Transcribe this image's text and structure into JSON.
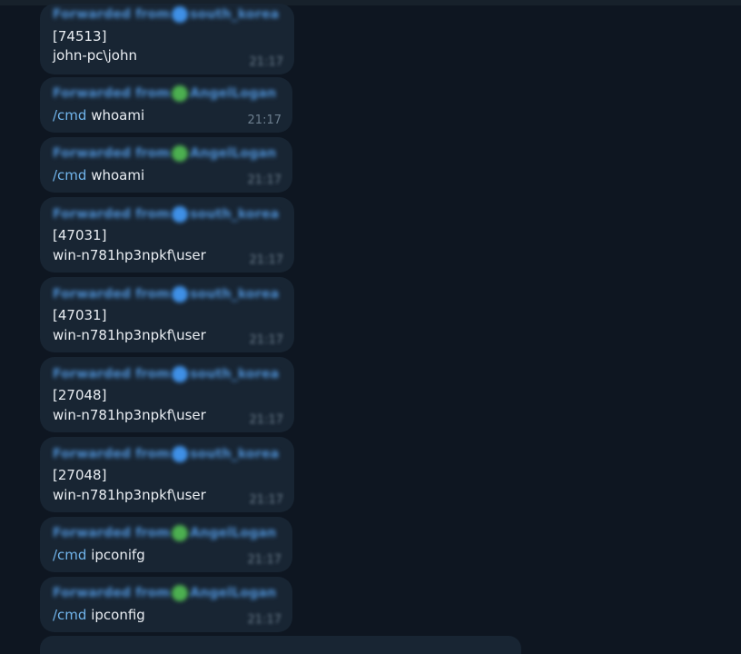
{
  "colors": {
    "background": "#0e1621",
    "bubble": "#182533",
    "text": "#e9edf2",
    "command": "#71b5ec",
    "timestamp": "#6d7f8f",
    "badge_blue": "#3f90e6",
    "badge_green": "#4caf50"
  },
  "messages": [
    {
      "forward_header": "Forwarded from south_korea",
      "badge": "blue",
      "lines": [
        "[74513]",
        "john-pc\\john"
      ],
      "time": "21:17"
    },
    {
      "forward_header": "Forwarded from AngelLogan",
      "badge": "green",
      "command": "/cmd",
      "text": "whoami",
      "time": "21:17"
    },
    {
      "forward_header": "Forwarded from AngelLogan",
      "badge": "green",
      "command": "/cmd",
      "text": "whoami",
      "time": "21:17"
    },
    {
      "forward_header": "Forwarded from south_korea",
      "badge": "blue",
      "lines": [
        "[47031]",
        "win-n781hp3npkf\\user"
      ],
      "time": "21:17"
    },
    {
      "forward_header": "Forwarded from south_korea",
      "badge": "blue",
      "lines": [
        "[47031]",
        "win-n781hp3npkf\\user"
      ],
      "time": "21:17"
    },
    {
      "forward_header": "Forwarded from south_korea",
      "badge": "blue",
      "lines": [
        "[27048]",
        "win-n781hp3npkf\\user"
      ],
      "time": "21:17"
    },
    {
      "forward_header": "Forwarded from south_korea",
      "badge": "blue",
      "lines": [
        "[27048]",
        "win-n781hp3npkf\\user"
      ],
      "time": "21:17"
    },
    {
      "forward_header": "Forwarded from AngelLogan",
      "badge": "green",
      "command": "/cmd",
      "text": "ipconifg",
      "time": "21:17"
    },
    {
      "forward_header": "Forwarded from AngelLogan",
      "badge": "green",
      "command": "/cmd",
      "text": "ipconfig",
      "time": "21:17"
    }
  ]
}
